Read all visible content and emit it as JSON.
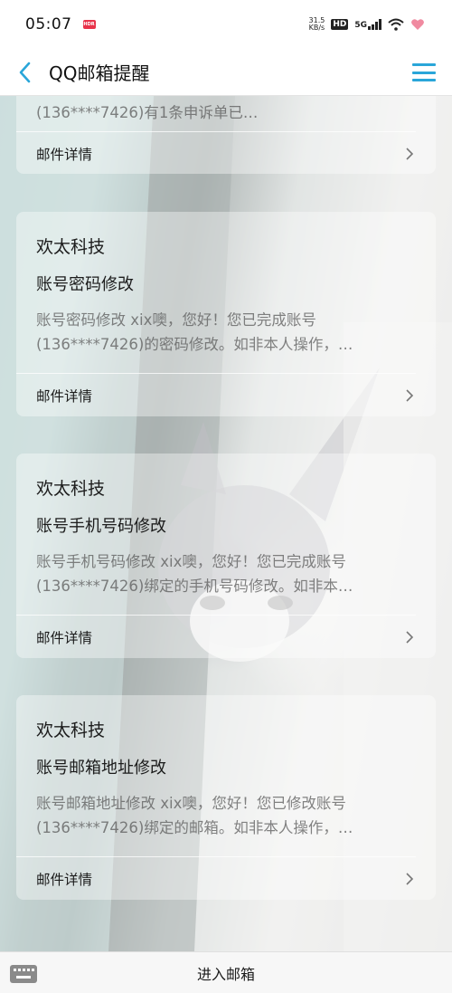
{
  "status_bar": {
    "time": "05:07",
    "net_speed_value": "31.5",
    "net_speed_unit": "KB/s",
    "hd_label": "HD",
    "network_label": "5G"
  },
  "header": {
    "title": "QQ邮箱提醒"
  },
  "messages": [
    {
      "sender": "",
      "subject": "",
      "preview": "(136****7426)有1条申诉单已…",
      "detail_label": "邮件详情"
    },
    {
      "sender": "欢太科技",
      "subject": "账号密码修改",
      "preview": "账号密码修改 xix噢，您好！您已完成账号(136****7426)的密码修改。如非本人操作，…",
      "detail_label": "邮件详情"
    },
    {
      "sender": "欢太科技",
      "subject": "账号手机号码修改",
      "preview": "账号手机号码修改 xix噢，您好！您已完成账号(136****7426)绑定的手机号码修改。如非本…",
      "detail_label": "邮件详情"
    },
    {
      "sender": "欢太科技",
      "subject": "账号邮箱地址修改",
      "preview": "账号邮箱地址修改 xix噢，您好！您已修改账号(136****7426)绑定的邮箱。如非本人操作，…",
      "detail_label": "邮件详情"
    }
  ],
  "bottom_bar": {
    "enter_mailbox_label": "进入邮箱"
  },
  "colors": {
    "accent": "#2aa6d9",
    "title_text": "#111111"
  }
}
